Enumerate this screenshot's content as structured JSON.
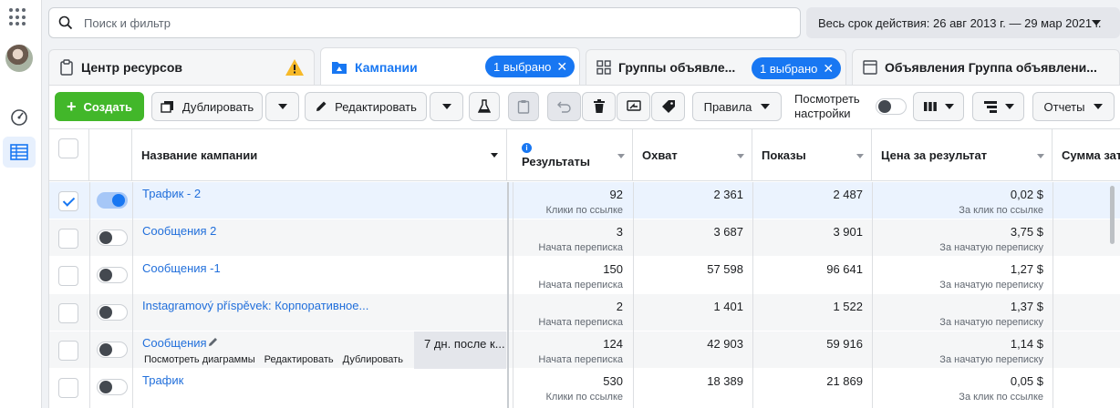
{
  "search": {
    "placeholder": "Поиск и фильтр"
  },
  "date_range": {
    "label": "Весь срок действия: 26 авг 2013 г. — 29 мар 2021 г."
  },
  "tabs": [
    {
      "label": "Центр ресурсов",
      "icon": "clipboard-icon",
      "warning_icon": "warning-icon"
    },
    {
      "label": "Кампании",
      "icon": "folder-icon",
      "badge": "1 выбрано",
      "active": true
    },
    {
      "label": "Группы объявле...",
      "icon": "grid-icon",
      "badge": "1 выбрано"
    },
    {
      "label": "Объявления Группа объявлени...",
      "icon": "ad-icon"
    }
  ],
  "toolbar": {
    "create_label": "Создать",
    "duplicate_label": "Дублировать",
    "edit_label": "Редактировать",
    "rules_label": "Правила",
    "view_settings_line1": "Посмотреть",
    "view_settings_line2": "настройки",
    "reports_label": "Отчеты"
  },
  "columns": {
    "name": "Название кампании",
    "results": "Результаты",
    "reach": "Охват",
    "impressions": "Показы",
    "cost_per_result": "Цена за результат",
    "amount_spent": "Сумма зат"
  },
  "rows": [
    {
      "name": "Трафик - 2",
      "results": "92",
      "results_sub": "Клики по ссылке",
      "reach": "2 361",
      "impressions": "2 487",
      "cost": "0,02 $",
      "cost_sub": "За клик по ссылке",
      "checked": true,
      "on": true
    },
    {
      "name": "Сообщения 2",
      "results": "3",
      "results_sub": "Начата переписка",
      "reach": "3 687",
      "impressions": "3 901",
      "cost": "3,75 $",
      "cost_sub": "За начатую переписку",
      "checked": false,
      "on": false
    },
    {
      "name": "Сообщения -1",
      "results": "150",
      "results_sub": "Начата переписка",
      "reach": "57 598",
      "impressions": "96 641",
      "cost": "1,27 $",
      "cost_sub": "За начатую переписку",
      "checked": false,
      "on": false
    },
    {
      "name": "Instagramový příspěvek: Корпоративное...",
      "results": "2",
      "results_sub": "Начата переписка",
      "reach": "1 401",
      "impressions": "1 522",
      "cost": "1,37 $",
      "cost_sub": "За начатую переписку",
      "checked": false,
      "on": false
    },
    {
      "name": "Сообщения",
      "results": "124",
      "results_sub": "Начата переписка",
      "reach": "42 903",
      "impressions": "59 916",
      "cost": "1,14 $",
      "cost_sub": "За начатую переписку",
      "checked": false,
      "on": false,
      "hover_actions": [
        "Посмотреть диаграммы",
        "Редактировать",
        "Дублировать"
      ],
      "schedule": "7 дн. после к..."
    },
    {
      "name": "Трафик",
      "results": "530",
      "results_sub": "Клики по ссылке",
      "reach": "18 389",
      "impressions": "21 869",
      "cost": "0,05 $",
      "cost_sub": "За клик по ссылке",
      "checked": false,
      "on": false
    }
  ],
  "colors": {
    "accent": "#1877f2",
    "create": "#42b72a",
    "link": "#216fdb"
  }
}
